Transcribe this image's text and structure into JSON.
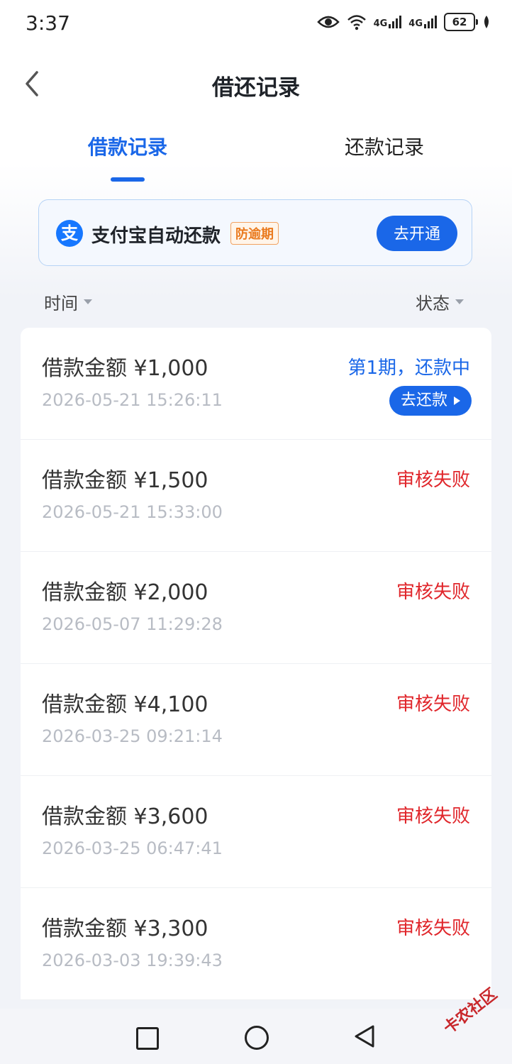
{
  "status_bar": {
    "time": "3:37",
    "net1": "4G",
    "net2": "4G",
    "battery": "62"
  },
  "header": {
    "title": "借还记录"
  },
  "tabs": [
    {
      "label": "借款记录",
      "active": true
    },
    {
      "label": "还款记录",
      "active": false
    }
  ],
  "banner": {
    "icon_text": "支",
    "text": "支付宝自动还款",
    "badge": "防逾期",
    "button": "去开通"
  },
  "filters": {
    "left": "时间",
    "right": "状态"
  },
  "records": [
    {
      "amount": "借款金额 ¥1,000",
      "date": "2026-05-21 15:26:11",
      "status": "第1期，还款中",
      "action": "去还款"
    },
    {
      "amount": "借款金额 ¥1,500",
      "date": "2026-05-21 15:33:00",
      "status": "审核失败"
    },
    {
      "amount": "借款金额 ¥2,000",
      "date": "2026-05-07 11:29:28",
      "status": "审核失败"
    },
    {
      "amount": "借款金额 ¥4,100",
      "date": "2026-03-25 09:21:14",
      "status": "审核失败"
    },
    {
      "amount": "借款金额 ¥3,600",
      "date": "2026-03-25 06:47:41",
      "status": "审核失败"
    },
    {
      "amount": "借款金额 ¥3,300",
      "date": "2026-03-03 19:39:43",
      "status": "审核失败"
    }
  ],
  "watermark": "卡农社区",
  "colors": {
    "accent": "#1a67e8",
    "fail": "#e0262b"
  }
}
